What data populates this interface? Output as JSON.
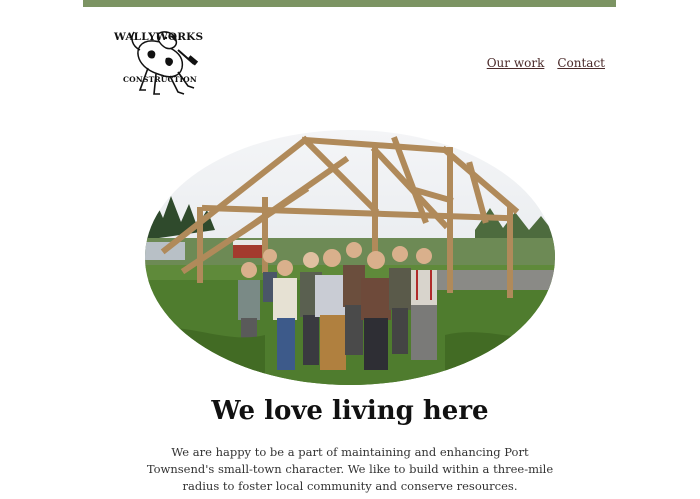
{
  "header": {
    "logo": {
      "line1": "WALLYWORKS",
      "line2": "CONSTRUCTION",
      "icon": "dog-with-hammer-icon"
    },
    "nav": [
      {
        "label": "Our work"
      },
      {
        "label": "Contact"
      }
    ]
  },
  "colors": {
    "topbar": "#7c9463",
    "link": "#4a2a2a"
  },
  "main": {
    "heading": "We love living here",
    "blurb": "We are happy to be a part of maintaining and enhancing Port Townsend's small-town character. We like to build within a three-mile radius to foster local community and conserve resources."
  }
}
